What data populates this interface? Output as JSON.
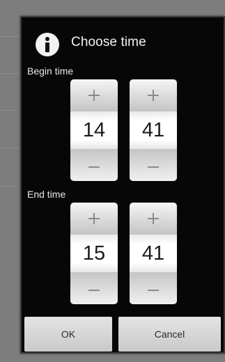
{
  "dialog": {
    "title": "Choose time",
    "icon": "info-icon"
  },
  "begin": {
    "label": "Begin time",
    "hour": "14",
    "minute": "41"
  },
  "end": {
    "label": "End time",
    "hour": "15",
    "minute": "41"
  },
  "buttons": {
    "ok": "OK",
    "cancel": "Cancel"
  },
  "icons": {
    "increment": "plus-icon",
    "decrement": "minus-icon"
  }
}
